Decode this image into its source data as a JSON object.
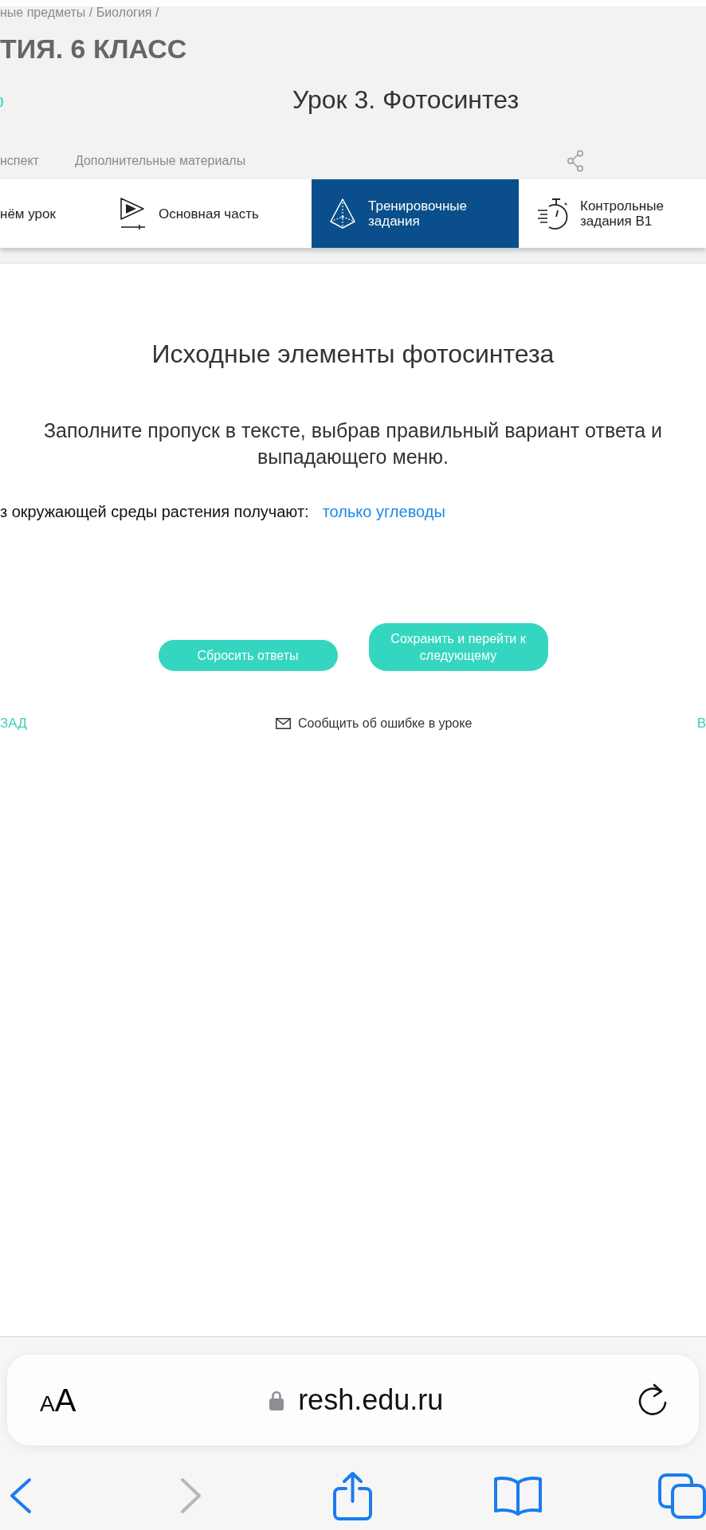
{
  "breadcrumb": "ные предметы / Биология /",
  "course_title": "ТИЯ. 6 КЛАСС",
  "lesson_title": "Урок 3. Фотосинтез",
  "lesson_links": [
    "нспект",
    "Дополнительные материалы"
  ],
  "section_tabs": [
    {
      "kind": "intro",
      "label": "нём урок",
      "selected": false
    },
    {
      "kind": "main",
      "label": "Основная часть",
      "selected": false
    },
    {
      "kind": "training",
      "label": "Тренировочные задания",
      "selected": true
    },
    {
      "kind": "control",
      "label": "Контрольные задания В1",
      "selected": false
    }
  ],
  "task": {
    "title": "Исходные элементы фотосинтеза",
    "instruction_lines": [
      "Заполните пропуск в тексте, выбрав правильный вариант ответа и",
      "выпадающего меню."
    ],
    "sentence": "з окружающей среды растения получают:",
    "answer": {
      "value": "только углеводы"
    }
  },
  "buttons": [
    "Сбросить ответы",
    "Сохранить и перейти к следующему"
  ],
  "footer": {
    "back": "ЗАД",
    "report": "Сообщить об ошибке в уроке",
    "forward": "В"
  },
  "browser": {
    "text_size_button": "AA",
    "url": "resh.edu.ru",
    "back": {
      "disabled": false
    },
    "forward": {
      "disabled": true
    }
  }
}
